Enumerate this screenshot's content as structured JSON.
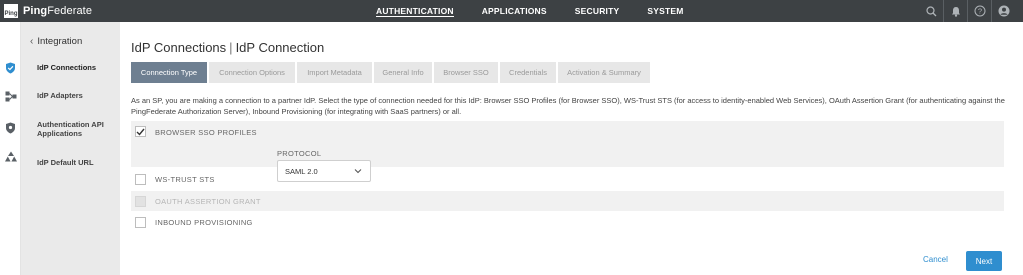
{
  "brand": {
    "logo_mark": "Ping",
    "name_bold": "Ping",
    "name_rest": "Federate"
  },
  "topnav": {
    "items": [
      {
        "label": "AUTHENTICATION",
        "active": true
      },
      {
        "label": "APPLICATIONS",
        "active": false
      },
      {
        "label": "SECURITY",
        "active": false
      },
      {
        "label": "SYSTEM",
        "active": false
      }
    ],
    "icons": [
      "search-icon",
      "bell-icon",
      "help-icon",
      "user-icon"
    ]
  },
  "rail": {
    "icons": [
      "shield-check-icon",
      "adapters-icon",
      "shield-icon",
      "users-icon"
    ],
    "accent": "#2f8ecf"
  },
  "sidebar": {
    "back_label": "Integration",
    "items": [
      {
        "label": "IdP Connections",
        "active": true
      },
      {
        "label": "IdP Adapters",
        "active": false
      },
      {
        "label": "Authentication API Applications",
        "active": false
      },
      {
        "label": "IdP Default URL",
        "active": false
      }
    ]
  },
  "main": {
    "title_part1": "IdP Connections",
    "title_sep": "|",
    "title_part2": "IdP Connection",
    "tabs": [
      {
        "label": "Connection Type",
        "active": true
      },
      {
        "label": "Connection Options",
        "active": false
      },
      {
        "label": "Import Metadata",
        "active": false
      },
      {
        "label": "General Info",
        "active": false
      },
      {
        "label": "Browser SSO",
        "active": false
      },
      {
        "label": "Credentials",
        "active": false
      },
      {
        "label": "Activation & Summary",
        "active": false
      }
    ],
    "description": "As an SP, you are making a connection to a partner IdP. Select the type of connection needed for this IdP: Browser SSO Profiles (for Browser SSO), WS-Trust STS (for access to identity-enabled Web Services), OAuth Assertion Grant (for authenticating against the PingFederate Authorization Server), Inbound Provisioning (for integrating with SaaS partners) or all.",
    "options": [
      {
        "label": "BROWSER SSO PROFILES",
        "checked": true,
        "disabled": false
      },
      {
        "label": "WS-TRUST STS",
        "checked": false,
        "disabled": false
      },
      {
        "label": "OAUTH ASSERTION GRANT",
        "checked": false,
        "disabled": true
      },
      {
        "label": "INBOUND PROVISIONING",
        "checked": false,
        "disabled": false
      }
    ],
    "protocol_label": "PROTOCOL",
    "protocol_value": "SAML 2.0",
    "cancel_label": "Cancel",
    "next_label": "Next"
  }
}
